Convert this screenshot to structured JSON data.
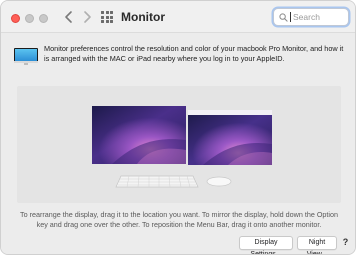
{
  "window": {
    "title": "Monitor",
    "traffic_lights": {
      "close_color": "#ff5f57",
      "inactive_color": "#c8c8c8"
    },
    "nav": {
      "back_icon": "chevron-left-icon",
      "forward_icon": "chevron-right-icon",
      "grid_icon": "grid-icon"
    }
  },
  "search": {
    "placeholder": "Search",
    "icon": "search-icon"
  },
  "description": "Monitor preferences control the resolution and color of your macbook Pro Monitor, and how it is arranged with the MAC or iPad nearby where you log in to your AppleID.",
  "arrangement": {
    "displays": [
      {
        "name": "display-1"
      },
      {
        "name": "display-2",
        "has_menu_bar": true
      }
    ]
  },
  "instructions": "To rearrange the display, drag it to the location you want. To mirror the display, hold down the Option key and drag one over the other. To reposition the Menu Bar, drag it onto another monitor.",
  "buttons": {
    "display_settings": "Display Settings...",
    "night_view": "Night View...",
    "help": "?"
  }
}
